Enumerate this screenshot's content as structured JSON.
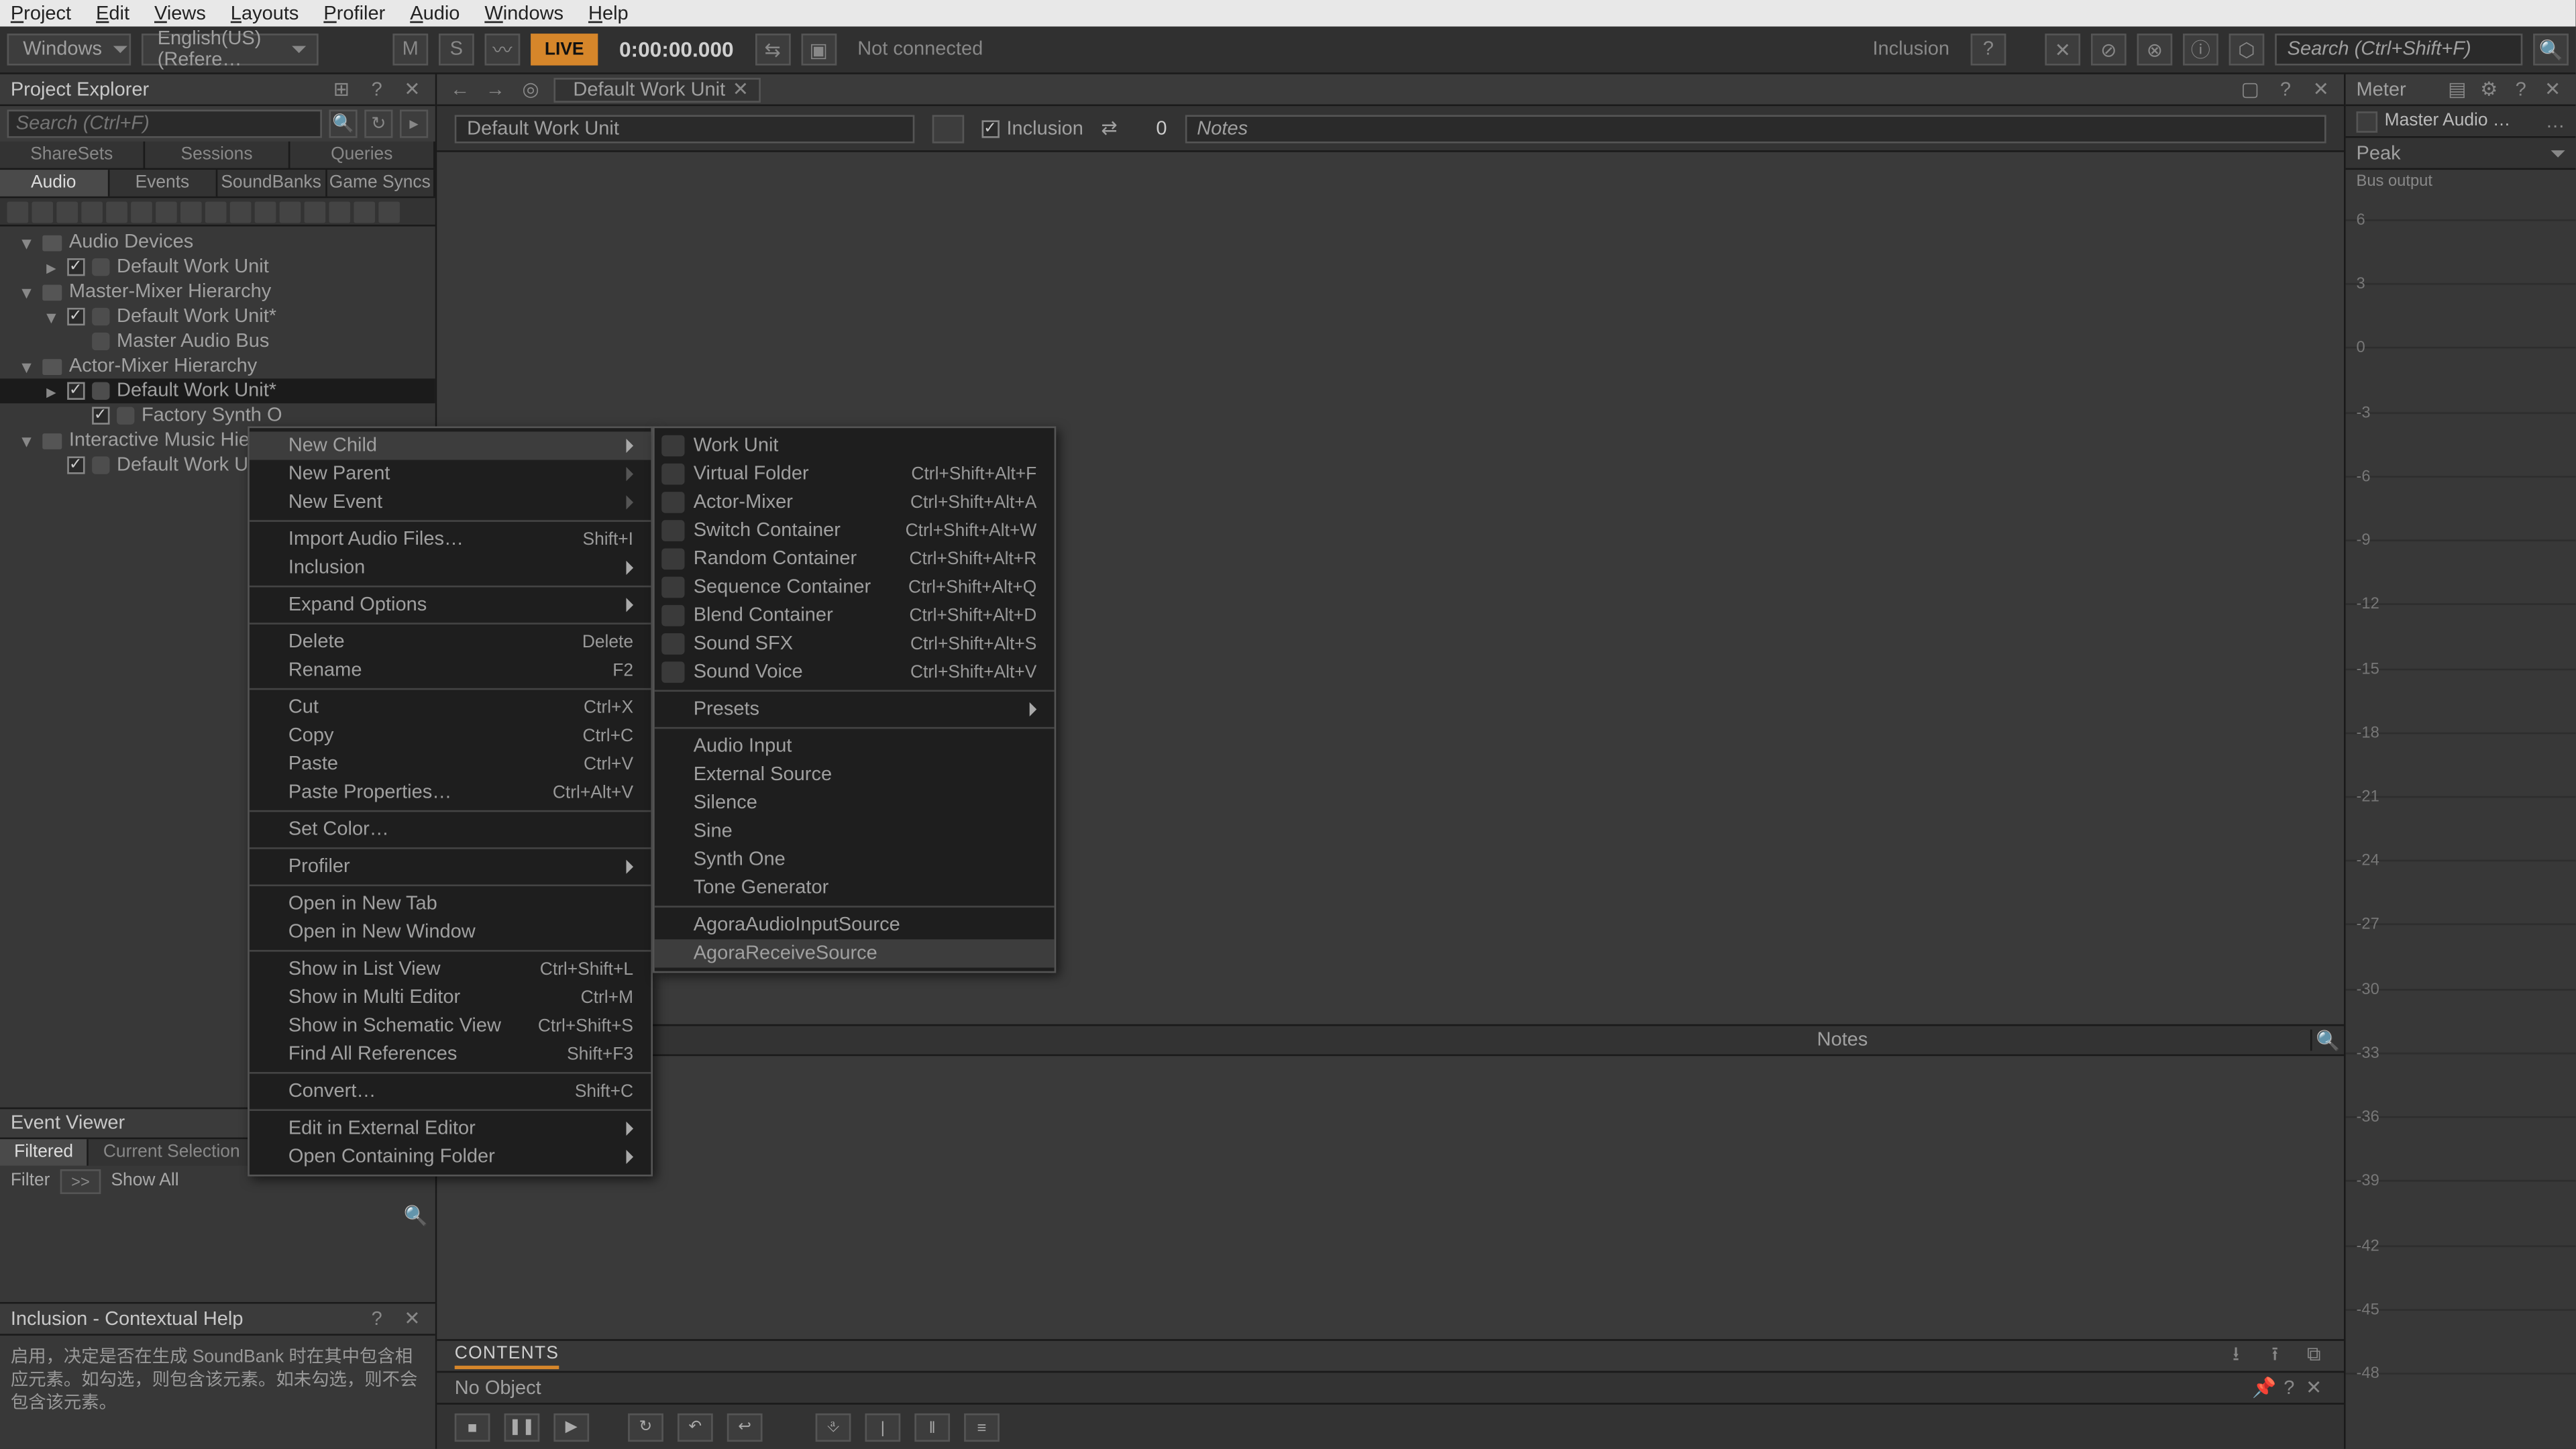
{
  "menubar": {
    "items": [
      "Project",
      "Edit",
      "Views",
      "Layouts",
      "Profiler",
      "Audio",
      "Windows",
      "Help"
    ]
  },
  "toolbar": {
    "windows_dd": "Windows",
    "lang_dd": "English(US) (Refere…",
    "m": "M",
    "s": "S",
    "live": "LIVE",
    "time": "0:00:00.000",
    "conn": "Not connected",
    "inclusion": "Inclusion",
    "help": "?",
    "search_placeholder": "Search (Ctrl+Shift+F)"
  },
  "explorer": {
    "title": "Project Explorer",
    "search_placeholder": "Search (Ctrl+F)",
    "tabs1": [
      "ShareSets",
      "Sessions",
      "Queries"
    ],
    "tabs2": [
      "Audio",
      "Events",
      "SoundBanks",
      "Game Syncs"
    ],
    "tree": {
      "n0": "Audio Devices",
      "n1": "Default Work Unit",
      "n2": "Master-Mixer Hierarchy",
      "n3": "Default Work Unit*",
      "n4": "Master Audio Bus",
      "n5": "Actor-Mixer Hierarchy",
      "n6": "Default Work Unit*",
      "n7": "Factory Synth O",
      "n8": "Interactive Music Hiera",
      "n9": "Default Work U"
    }
  },
  "eventViewer": {
    "title": "Event Viewer",
    "tabs": [
      "Filtered",
      "Current Selection"
    ],
    "filter_lbl": "Filter",
    "gg": ">>",
    "showall": "Show All"
  },
  "help": {
    "title": "Inclusion - Contextual Help",
    "body": "启用，决定是否在生成 SoundBank 时在其中包含相应元素。如勾选，则包含该元素。如未勾选，则不会包含该元素。"
  },
  "center": {
    "tab": "Default Work Unit",
    "objname": "Default Work Unit",
    "inclusion": "Inclusion",
    "count": "0",
    "notes_placeholder": "Notes",
    "notes_header": "Notes",
    "contents": "CONTENTS",
    "noobject": "No Object"
  },
  "meter": {
    "title": "Meter",
    "source": "Master Audio …",
    "mode": "Peak",
    "buslabel": "Bus output",
    "ticks": [
      "6",
      "3",
      "0",
      "-3",
      "-6",
      "-9",
      "-12",
      "-15",
      "-18",
      "-21",
      "-24",
      "-27",
      "-30",
      "-33",
      "-36",
      "-39",
      "-42",
      "-45",
      "-48"
    ]
  },
  "ctx1": [
    {
      "t": "row",
      "label": "New Child",
      "sub": true,
      "hi": true
    },
    {
      "t": "row",
      "label": "New Parent",
      "sub": true,
      "disabled": true
    },
    {
      "t": "row",
      "label": "New Event",
      "sub": true,
      "disabled": true
    },
    {
      "t": "sep"
    },
    {
      "t": "row",
      "label": "Import Audio Files…",
      "scut": "Shift+I"
    },
    {
      "t": "row",
      "label": "Inclusion",
      "sub": true
    },
    {
      "t": "sep"
    },
    {
      "t": "row",
      "label": "Expand Options",
      "sub": true
    },
    {
      "t": "sep"
    },
    {
      "t": "row",
      "label": "Delete",
      "scut": "Delete",
      "disabled": true
    },
    {
      "t": "row",
      "label": "Rename",
      "scut": "F2"
    },
    {
      "t": "sep"
    },
    {
      "t": "row",
      "label": "Cut",
      "scut": "Ctrl+X"
    },
    {
      "t": "row",
      "label": "Copy",
      "scut": "Ctrl+C"
    },
    {
      "t": "row",
      "label": "Paste",
      "scut": "Ctrl+V"
    },
    {
      "t": "row",
      "label": "Paste Properties…",
      "scut": "Ctrl+Alt+V"
    },
    {
      "t": "sep"
    },
    {
      "t": "row",
      "label": "Set Color…"
    },
    {
      "t": "sep"
    },
    {
      "t": "row",
      "label": "Profiler",
      "sub": true
    },
    {
      "t": "sep"
    },
    {
      "t": "row",
      "label": "Open in New Tab"
    },
    {
      "t": "row",
      "label": "Open in New Window"
    },
    {
      "t": "sep"
    },
    {
      "t": "row",
      "label": "Show in List View",
      "scut": "Ctrl+Shift+L"
    },
    {
      "t": "row",
      "label": "Show in Multi Editor",
      "scut": "Ctrl+M"
    },
    {
      "t": "row",
      "label": "Show in Schematic View",
      "scut": "Ctrl+Shift+S"
    },
    {
      "t": "row",
      "label": "Find All References",
      "scut": "Shift+F3"
    },
    {
      "t": "sep"
    },
    {
      "t": "row",
      "label": "Convert…",
      "scut": "Shift+C",
      "disabled": true
    },
    {
      "t": "sep"
    },
    {
      "t": "row",
      "label": "Edit in External Editor",
      "sub": true
    },
    {
      "t": "row",
      "label": "Open Containing Folder",
      "sub": true
    }
  ],
  "ctx2": [
    {
      "t": "row",
      "label": "Work Unit",
      "ico": true
    },
    {
      "t": "row",
      "label": "Virtual Folder",
      "scut": "Ctrl+Shift+Alt+F",
      "ico": true
    },
    {
      "t": "row",
      "label": "Actor-Mixer",
      "scut": "Ctrl+Shift+Alt+A",
      "ico": true
    },
    {
      "t": "row",
      "label": "Switch Container",
      "scut": "Ctrl+Shift+Alt+W",
      "ico": true
    },
    {
      "t": "row",
      "label": "Random Container",
      "scut": "Ctrl+Shift+Alt+R",
      "ico": true
    },
    {
      "t": "row",
      "label": "Sequence Container",
      "scut": "Ctrl+Shift+Alt+Q",
      "ico": true
    },
    {
      "t": "row",
      "label": "Blend Container",
      "scut": "Ctrl+Shift+Alt+D",
      "ico": true
    },
    {
      "t": "row",
      "label": "Sound SFX",
      "scut": "Ctrl+Shift+Alt+S",
      "ico": true
    },
    {
      "t": "row",
      "label": "Sound Voice",
      "scut": "Ctrl+Shift+Alt+V",
      "ico": true
    },
    {
      "t": "sep"
    },
    {
      "t": "row",
      "label": "Presets",
      "sub": true
    },
    {
      "t": "sep"
    },
    {
      "t": "row",
      "label": "Audio Input"
    },
    {
      "t": "row",
      "label": "External Source"
    },
    {
      "t": "row",
      "label": "Silence"
    },
    {
      "t": "row",
      "label": "Sine"
    },
    {
      "t": "row",
      "label": "Synth One"
    },
    {
      "t": "row",
      "label": "Tone Generator"
    },
    {
      "t": "sep"
    },
    {
      "t": "row",
      "label": "AgoraAudioInputSource"
    },
    {
      "t": "row",
      "label": "AgoraReceiveSource",
      "hi": true
    }
  ]
}
